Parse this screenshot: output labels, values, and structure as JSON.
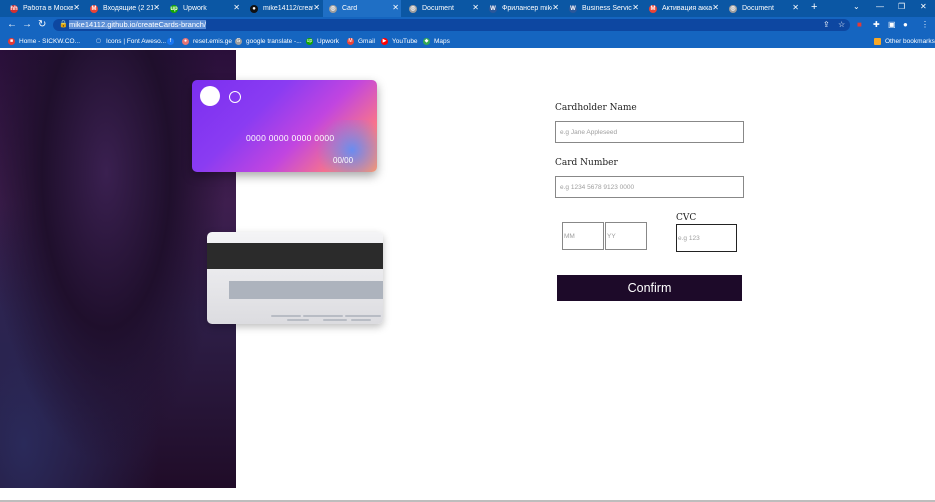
{
  "browser": {
    "tabs": [
      {
        "label": "Работа в Москве,",
        "favicon": "hh-icon",
        "color": "#d32f2f",
        "icon_text": "hh"
      },
      {
        "label": "Входящие (2 211)",
        "favicon": "gmail-icon",
        "color": "#ea4335",
        "icon_text": "M"
      },
      {
        "label": "Upwork",
        "favicon": "upwork-icon",
        "color": "#14a800",
        "icon_text": "up"
      },
      {
        "label": "mike14112/create",
        "favicon": "github-icon",
        "color": "#111111",
        "icon_text": "●"
      },
      {
        "label": "Card",
        "favicon": "globe-icon",
        "color": "#9e9e9e",
        "icon_text": "◎"
      },
      {
        "label": "Document",
        "favicon": "globe-icon",
        "color": "#9e9e9e",
        "icon_text": "◎"
      },
      {
        "label": "Фрилансер mike1",
        "favicon": "word-icon",
        "color": "#2b579a",
        "icon_text": "W"
      },
      {
        "label": "Business Services",
        "favicon": "word-icon",
        "color": "#2b579a",
        "icon_text": "W"
      },
      {
        "label": "Активация аккаун",
        "favicon": "gmail-icon",
        "color": "#ea4335",
        "icon_text": "M"
      },
      {
        "label": "Document",
        "favicon": "globe-icon",
        "color": "#9e9e9e",
        "icon_text": "◎"
      }
    ],
    "active_tab_index": 4,
    "new_tab": "+",
    "window_controls": {
      "dropdown": "⌄",
      "minimize": "—",
      "restore": "❐",
      "close": "✕"
    },
    "nav": {
      "back": "←",
      "forward": "→",
      "reload": "↻"
    },
    "url": "mike14112.github.io/createCards-branch/",
    "bookmarks": [
      {
        "label": "Home - SICKW.CO...",
        "icon": "sickw-icon",
        "color": "#e53935",
        "icon_text": "■"
      },
      {
        "label": "Icons | Font Aweso...",
        "icon": "folder-icon",
        "color": "#1565c0",
        "icon_text": "▢"
      },
      {
        "label": "",
        "icon": "facebook-icon",
        "color": "#1877f2",
        "icon_text": "f"
      },
      {
        "label": "reset.emis.ge",
        "icon": "emis-icon",
        "color": "#e57373",
        "icon_text": "●"
      },
      {
        "label": "google translate -...",
        "icon": "google-icon",
        "color": "#9e9e9e",
        "icon_text": "G"
      },
      {
        "label": "Upwork",
        "icon": "upwork-icon",
        "color": "#14a800",
        "icon_text": "up"
      },
      {
        "label": "Gmail",
        "icon": "gmail-icon",
        "color": "#ea4335",
        "icon_text": "M"
      },
      {
        "label": "YouTube",
        "icon": "youtube-icon",
        "color": "#ff0000",
        "icon_text": "▶"
      },
      {
        "label": "Maps",
        "icon": "maps-icon",
        "color": "#34a853",
        "icon_text": "◆"
      }
    ],
    "other_bookmarks": "Other bookmarks"
  },
  "card": {
    "number": "0000 0000 0000 0000",
    "expiry": "00/00"
  },
  "form": {
    "cardholder_label": "Cardholder Name",
    "cardholder_placeholder": "e.g  Jane Appleseed",
    "number_label": "Card Number",
    "number_placeholder": "e.g 1234 5678 9123 0000",
    "mm_placeholder": "MM",
    "yy_placeholder": "YY",
    "cvc_label": "CVC",
    "cvc_placeholder": "e.g 123",
    "confirm_label": "Confirm"
  }
}
